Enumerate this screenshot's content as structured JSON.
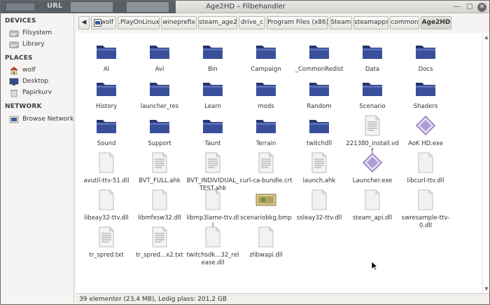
{
  "window": {
    "title": "Age2HD – Filbehandler",
    "close_glyph": "✕",
    "maximize_glyph": "▢",
    "minimize_glyph": "—"
  },
  "background_app": {
    "url_label": "URL"
  },
  "sidebar": {
    "sections": [
      {
        "heading": "DEVICES",
        "items": [
          {
            "label": "Filsystem",
            "icon": "drive-icon"
          },
          {
            "label": "Library",
            "icon": "drive-icon"
          }
        ]
      },
      {
        "heading": "PLACES",
        "items": [
          {
            "label": "wolf",
            "icon": "home-icon"
          },
          {
            "label": "Desktop",
            "icon": "desktop-icon"
          },
          {
            "label": "Papirkurv",
            "icon": "trash-icon"
          }
        ]
      },
      {
        "heading": "NETWORK",
        "items": [
          {
            "label": "Browse Network",
            "icon": "network-icon"
          }
        ]
      }
    ]
  },
  "pathbar": {
    "back_glyph": "◀",
    "crumbs": [
      "wolf",
      ".PlayOnLinux",
      "wineprefix",
      "steam_age2",
      "drive_c",
      "Program Files (x86)",
      "Steam",
      "steamapps",
      "common",
      "Age2HD"
    ],
    "active_index": 9
  },
  "files": [
    {
      "name": "AI",
      "type": "folder"
    },
    {
      "name": "Avi",
      "type": "folder"
    },
    {
      "name": "Bin",
      "type": "folder"
    },
    {
      "name": "Campaign",
      "type": "folder"
    },
    {
      "name": "_CommonRedist",
      "type": "folder"
    },
    {
      "name": "Data",
      "type": "folder"
    },
    {
      "name": "Docs",
      "type": "folder"
    },
    {
      "name": "History",
      "type": "folder"
    },
    {
      "name": "launcher_res",
      "type": "folder"
    },
    {
      "name": "Learn",
      "type": "folder"
    },
    {
      "name": "mods",
      "type": "folder"
    },
    {
      "name": "Random",
      "type": "folder"
    },
    {
      "name": "Scenario",
      "type": "folder"
    },
    {
      "name": "Shaders",
      "type": "folder"
    },
    {
      "name": "Sound",
      "type": "folder"
    },
    {
      "name": "Support",
      "type": "folder"
    },
    {
      "name": "Taunt",
      "type": "folder"
    },
    {
      "name": "Terrain",
      "type": "folder"
    },
    {
      "name": "twitchdll",
      "type": "folder"
    },
    {
      "name": "221380_install.vdf",
      "type": "text"
    },
    {
      "name": "AoK HD.exe",
      "type": "exe"
    },
    {
      "name": "avutil-ttv-51.dll",
      "type": "blank"
    },
    {
      "name": "BVT_FULL.ahk",
      "type": "text"
    },
    {
      "name": "BVT_INDIVIDUAL_TEST.ahk",
      "type": "text"
    },
    {
      "name": "curl-ca-bundle.crt",
      "type": "text"
    },
    {
      "name": "launch.ahk",
      "type": "text"
    },
    {
      "name": "Launcher.exe",
      "type": "exe"
    },
    {
      "name": "libcurl-ttv.dll",
      "type": "blank"
    },
    {
      "name": "libeay32-ttv.dll",
      "type": "blank"
    },
    {
      "name": "libmfxsw32.dll",
      "type": "blank"
    },
    {
      "name": "libmp3lame-ttv.dll",
      "type": "blank"
    },
    {
      "name": "scenariobkg.bmp",
      "type": "image"
    },
    {
      "name": "ssleay32-ttv.dll",
      "type": "blank"
    },
    {
      "name": "steam_api.dll",
      "type": "blank"
    },
    {
      "name": "swresample-ttv-0.dll",
      "type": "blank"
    },
    {
      "name": "tr_spred.txt",
      "type": "text"
    },
    {
      "name": "tr_spred...x2.txt",
      "type": "text"
    },
    {
      "name": "twitchsdk...32_release.dll",
      "type": "blank"
    },
    {
      "name": "zlibwapi.dll",
      "type": "blank"
    }
  ],
  "statusbar": {
    "text": "39 elementer (23,4 MB), Ledig plass: 201,2 GB"
  },
  "colors": {
    "folder_front": "#3a4f9b",
    "folder_back": "#25336f",
    "exe_accent": "#8a72c0"
  }
}
